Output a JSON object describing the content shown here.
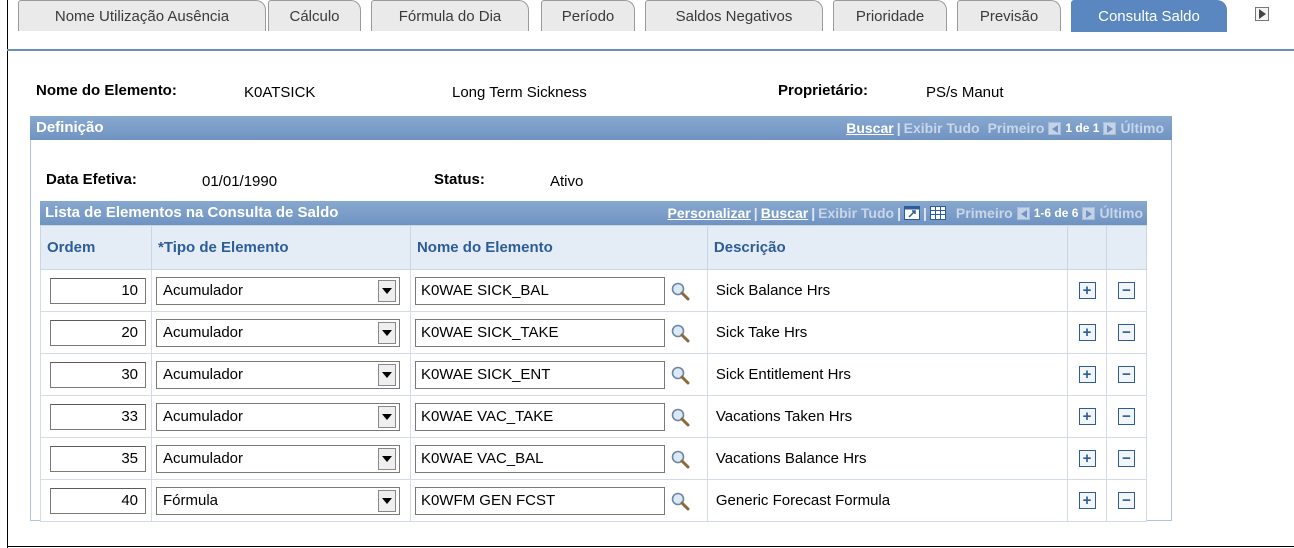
{
  "tabs": [
    {
      "label": "Nome Utilização Ausência",
      "active": false
    },
    {
      "label": "Cálculo",
      "active": false
    },
    {
      "label": "Fórmula do Dia",
      "active": false
    },
    {
      "label": "Período",
      "active": false
    },
    {
      "label": "Saldos Negativos",
      "active": false
    },
    {
      "label": "Prioridade",
      "active": false
    },
    {
      "label": "Previsão",
      "active": false
    },
    {
      "label": "Consulta Saldo",
      "active": true
    }
  ],
  "header": {
    "element_name_label": "Nome do Elemento:",
    "element_name_value": "K0ATSICK",
    "element_description": "Long Term Sickness",
    "owner_label": "Proprietário:",
    "owner_value": "PS/s Manut"
  },
  "definition": {
    "title": "Definição",
    "nav": {
      "find": "Buscar",
      "view_all": "Exibir Tudo",
      "first": "Primeiro",
      "count": "1 de 1",
      "last": "Último"
    },
    "effective_date_label": "Data Efetiva:",
    "effective_date_value": "01/01/1990",
    "status_label": "Status:",
    "status_value": "Ativo"
  },
  "grid": {
    "title": "Lista de Elementos na Consulta de Saldo",
    "nav": {
      "personalize": "Personalizar",
      "find": "Buscar",
      "view_all": "Exibir Tudo",
      "first": "Primeiro",
      "count": "1-6 de 6",
      "last": "Último"
    },
    "columns": {
      "order": "Ordem",
      "element_type": "*Tipo de Elemento",
      "element_name": "Nome do Elemento",
      "description": "Descrição"
    },
    "rows": [
      {
        "order": "10",
        "type": "Acumulador",
        "name": "K0WAE SICK_BAL",
        "description": "Sick Balance Hrs"
      },
      {
        "order": "20",
        "type": "Acumulador",
        "name": "K0WAE SICK_TAKE",
        "description": "Sick Take Hrs"
      },
      {
        "order": "30",
        "type": "Acumulador",
        "name": "K0WAE SICK_ENT",
        "description": "Sick Entitlement Hrs"
      },
      {
        "order": "33",
        "type": "Acumulador",
        "name": "K0WAE VAC_TAKE",
        "description": "Vacations Taken Hrs"
      },
      {
        "order": "35",
        "type": "Acumulador",
        "name": "K0WAE VAC_BAL",
        "description": "Vacations Balance Hrs"
      },
      {
        "order": "40",
        "type": "Fórmula",
        "name": "K0WFM GEN FCST",
        "description": "Generic Forecast Formula"
      }
    ],
    "add_symbol": "+",
    "remove_symbol": "−"
  }
}
